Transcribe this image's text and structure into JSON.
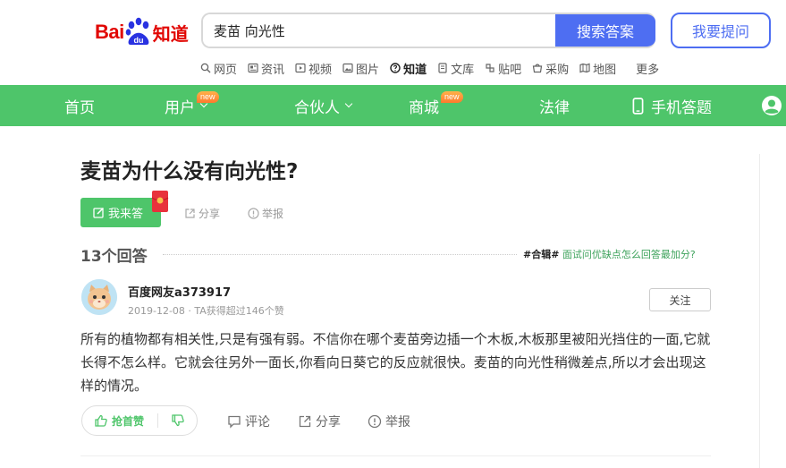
{
  "header": {
    "logo_bai": "Bai",
    "logo_du": "du",
    "logo_zhidao": "知道",
    "search_value": "麦苗 向光性",
    "search_button": "搜索答案",
    "ask_button": "我要提问",
    "accent_color": "#4e6ef2"
  },
  "subnav": {
    "items": [
      {
        "label": "网页",
        "icon": "search-icon"
      },
      {
        "label": "资讯",
        "icon": "news-icon"
      },
      {
        "label": "视频",
        "icon": "video-icon"
      },
      {
        "label": "图片",
        "icon": "image-icon"
      },
      {
        "label": "知道",
        "icon": "question-icon",
        "active": true
      },
      {
        "label": "文库",
        "icon": "doc-icon"
      },
      {
        "label": "贴吧",
        "icon": "tieba-icon"
      },
      {
        "label": "采购",
        "icon": "shop-icon"
      },
      {
        "label": "地图",
        "icon": "map-icon"
      }
    ],
    "more": "更多"
  },
  "greennav": {
    "color": "#4ec56a",
    "items": [
      {
        "label": "首页"
      },
      {
        "label": "用户",
        "badge": "new",
        "dropdown": true
      },
      {
        "label": "合伙人",
        "dropdown": true
      },
      {
        "label": "商城",
        "badge": "new"
      },
      {
        "label": "法律"
      },
      {
        "label": "手机答题",
        "icon": "phone-icon"
      }
    ]
  },
  "question": {
    "title": "麦苗为什么没有向光性?",
    "answer_button": "我来答",
    "share": "分享",
    "report": "举报"
  },
  "answers_header": {
    "count": "13个回答",
    "tag": "#合辑#",
    "link": "面试问优缺点怎么回答最加分?"
  },
  "answer": {
    "author": "百度网友a373917",
    "meta": "2019-12-08 · TA获得超过146个赞",
    "follow": "关注",
    "text": "所有的植物都有相关性,只是有强有弱。不信你在哪个麦苗旁边插一个木板,木板那里被阳光挡住的一面,它就长得不怎么样。它就会往另外一面长,你看向日葵它的反应就很快。麦苗的向光性稍微差点,所以才会出现这样的情况。",
    "vote_up": "抢首赞",
    "comment": "评论",
    "share": "分享",
    "report": "举报"
  }
}
